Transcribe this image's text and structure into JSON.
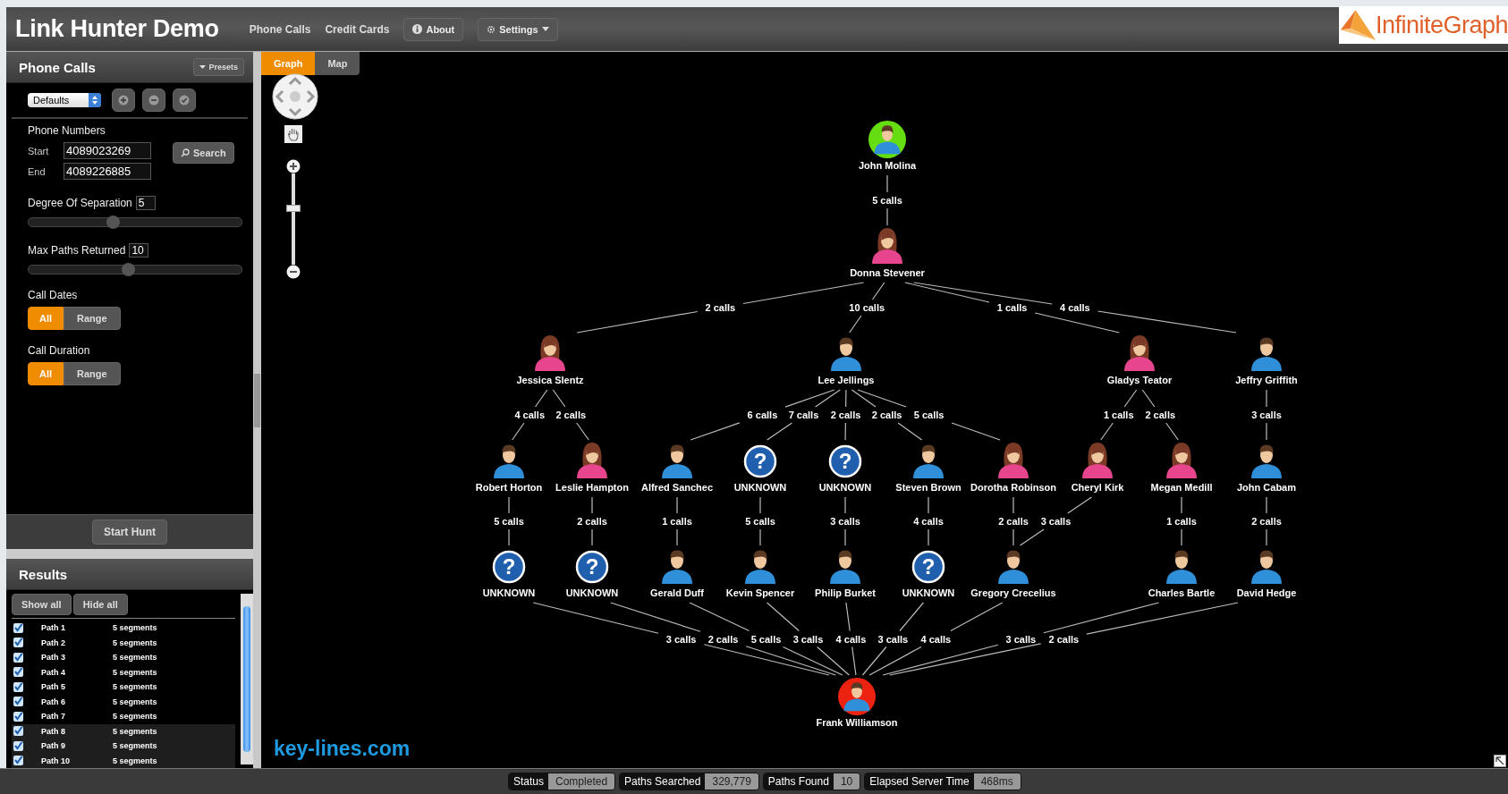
{
  "app": {
    "title": "Link Hunter Demo",
    "nav": [
      {
        "label": "Phone Calls"
      },
      {
        "label": "Credit Cards"
      }
    ],
    "buttons": [
      {
        "label": "About",
        "kind": "info"
      },
      {
        "label": "Settings",
        "kind": "menu"
      }
    ],
    "logo": "InfiniteGraph"
  },
  "sidebar": {
    "title": "Phone Calls",
    "presets_button": "Presets",
    "preset_select": "Defaults",
    "phone_numbers": {
      "heading": "Phone Numbers",
      "start_label": "Start",
      "start": "4089023269",
      "end_label": "End",
      "end": "4089226885",
      "search_button": "Search"
    },
    "sliders": [
      {
        "label": "Degree Of Separation",
        "value": "5",
        "level": 0.4
      },
      {
        "label": "Max Paths Returned",
        "value": "10",
        "level": 0.47
      }
    ],
    "toggles": [
      {
        "label": "Call Dates",
        "options": [
          {
            "label": "All",
            "selected": true
          },
          {
            "label": "Range",
            "selected": false
          }
        ]
      },
      {
        "label": "Call Duration",
        "options": [
          {
            "label": "All",
            "selected": true
          },
          {
            "label": "Range",
            "selected": false
          }
        ]
      }
    ],
    "start_button": "Start Hunt"
  },
  "results": {
    "title": "Results",
    "buttons": [
      "Show all",
      "Hide all"
    ],
    "paths": [
      {
        "name": "Path 1",
        "segments": "5 segments",
        "checked": true,
        "selected": false
      },
      {
        "name": "Path 2",
        "segments": "5 segments",
        "checked": true,
        "selected": false
      },
      {
        "name": "Path 3",
        "segments": "5 segments",
        "checked": true,
        "selected": false
      },
      {
        "name": "Path 4",
        "segments": "5 segments",
        "checked": true,
        "selected": false
      },
      {
        "name": "Path 5",
        "segments": "5 segments",
        "checked": true,
        "selected": false
      },
      {
        "name": "Path 6",
        "segments": "5 segments",
        "checked": true,
        "selected": false
      },
      {
        "name": "Path 7",
        "segments": "5 segments",
        "checked": true,
        "selected": false
      },
      {
        "name": "Path 8",
        "segments": "5 segments",
        "checked": true,
        "selected": true
      },
      {
        "name": "Path 9",
        "segments": "5 segments",
        "checked": true,
        "selected": true
      },
      {
        "name": "Path 10",
        "segments": "5 segments",
        "checked": true,
        "selected": true
      }
    ]
  },
  "graph": {
    "tabs": [
      {
        "label": "Graph",
        "selected": true
      },
      {
        "label": "Map",
        "selected": false
      }
    ],
    "zoom": {
      "level": 0.62
    },
    "nodes": [
      {
        "name": "John Molina",
        "kind": "male",
        "color": "#66dd11"
      },
      {
        "name": "Donna Stevener",
        "kind": "female"
      },
      {
        "name": "Jessica Slentz",
        "kind": "female"
      },
      {
        "name": "Lee Jellings",
        "kind": "male"
      },
      {
        "name": "Gladys Teator",
        "kind": "female"
      },
      {
        "name": "Jeffry Griffith",
        "kind": "male"
      },
      {
        "name": "Robert Horton",
        "kind": "male"
      },
      {
        "name": "Leslie Hampton",
        "kind": "female"
      },
      {
        "name": "Alfred Sanchec",
        "kind": "male"
      },
      {
        "name": "UNKNOWN",
        "kind": "unknown",
        "glyph": "?"
      },
      {
        "name": "UNKNOWN",
        "kind": "unknown",
        "glyph": "?"
      },
      {
        "name": "Steven Brown",
        "kind": "male"
      },
      {
        "name": "Dorotha Robinson",
        "kind": "female"
      },
      {
        "name": "Cheryl Kirk",
        "kind": "female"
      },
      {
        "name": "Megan Medill",
        "kind": "female"
      },
      {
        "name": "John Cabam",
        "kind": "male"
      },
      {
        "name": "UNKNOWN",
        "kind": "unknown",
        "glyph": "?"
      },
      {
        "name": "UNKNOWN",
        "kind": "unknown",
        "glyph": "?"
      },
      {
        "name": "Gerald Duff",
        "kind": "male"
      },
      {
        "name": "Kevin Spencer",
        "kind": "male"
      },
      {
        "name": "Philip Burket",
        "kind": "male"
      },
      {
        "name": "UNKNOWN",
        "kind": "unknown",
        "glyph": "?"
      },
      {
        "name": "Gregory Crecelius",
        "kind": "male"
      },
      {
        "name": "Charles Bartle",
        "kind": "male"
      },
      {
        "name": "David Hedge",
        "kind": "male"
      },
      {
        "name": "Frank Williamson",
        "kind": "male",
        "color": "#ee2211"
      }
    ],
    "edges": [
      {
        "label": "5 calls"
      },
      {
        "label": "2 calls"
      },
      {
        "label": "10 calls"
      },
      {
        "label": "1 calls"
      },
      {
        "label": "4 calls"
      },
      {
        "label": "4 calls"
      },
      {
        "label": "2 calls"
      },
      {
        "label": "6 calls"
      },
      {
        "label": "7 calls"
      },
      {
        "label": "2 calls"
      },
      {
        "label": "2 calls"
      },
      {
        "label": "5 calls"
      },
      {
        "label": "1 calls"
      },
      {
        "label": "2 calls"
      },
      {
        "label": "3 calls"
      },
      {
        "label": "5 calls"
      },
      {
        "label": "2 calls"
      },
      {
        "label": "1 calls"
      },
      {
        "label": "5 calls"
      },
      {
        "label": "3 calls"
      },
      {
        "label": "4 calls"
      },
      {
        "label": "2 calls"
      },
      {
        "label": "3 calls"
      },
      {
        "label": "1 calls"
      },
      {
        "label": "2 calls"
      },
      {
        "label": "3 calls"
      },
      {
        "label": "2 calls"
      },
      {
        "label": "5 calls"
      },
      {
        "label": "3 calls"
      },
      {
        "label": "4 calls"
      },
      {
        "label": "3 calls"
      },
      {
        "label": "4 calls"
      },
      {
        "label": "3 calls"
      },
      {
        "label": "2 calls"
      }
    ],
    "branding": "key-lines.com"
  },
  "status_bar": [
    {
      "label": "Status",
      "value": "Completed"
    },
    {
      "label": "Paths Searched",
      "value": "329,779"
    },
    {
      "label": "Paths Found",
      "value": "10"
    },
    {
      "label": "Elapsed Server Time",
      "value": "468ms"
    }
  ]
}
